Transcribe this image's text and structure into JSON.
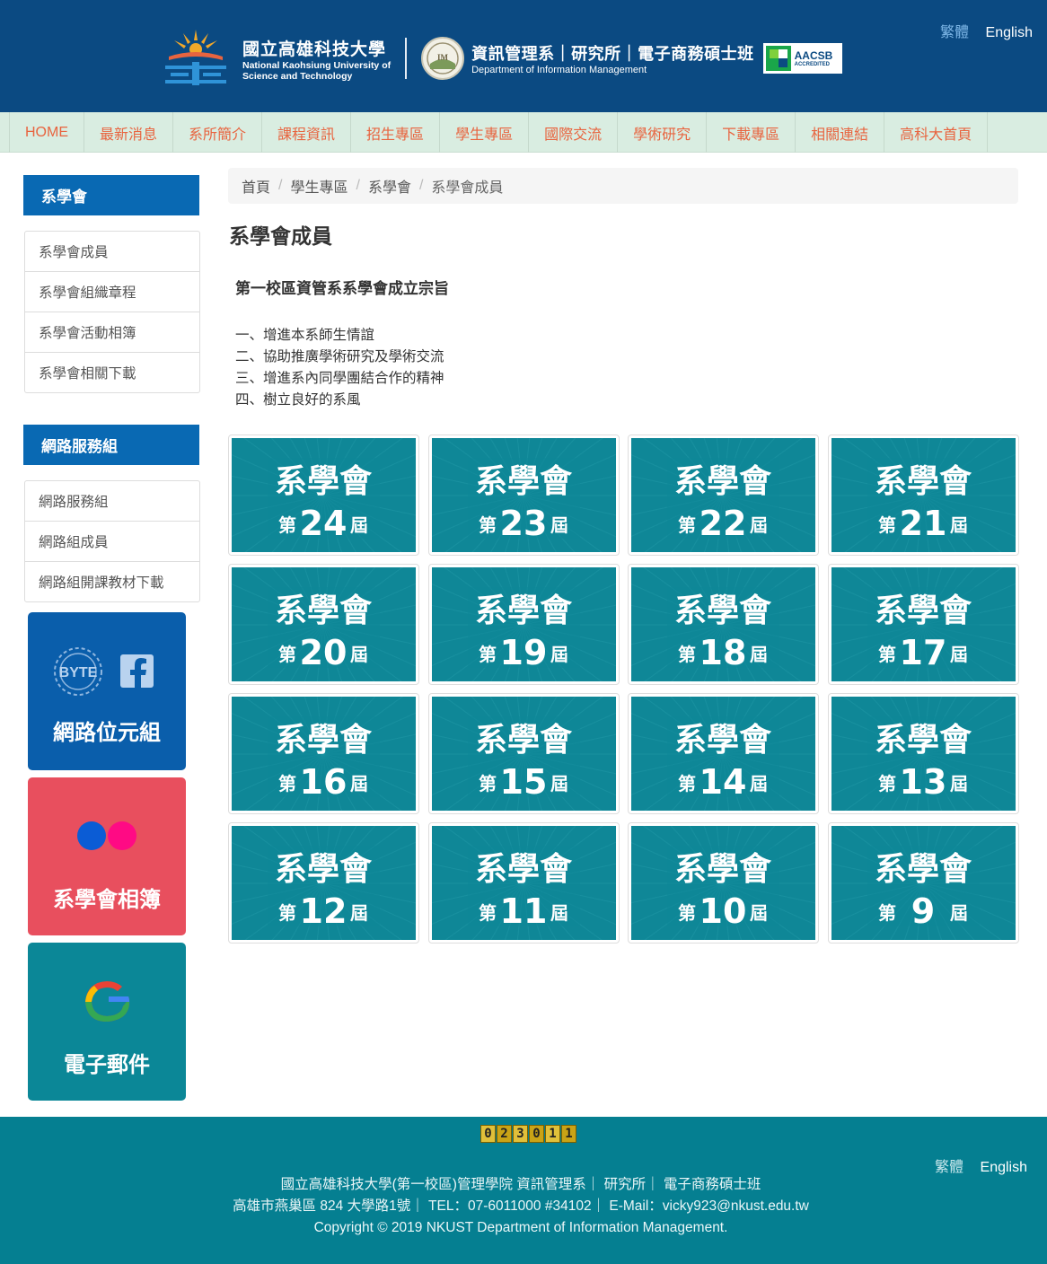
{
  "header": {
    "lang": [
      "繁體",
      "English"
    ],
    "univ_zh": "國立高雄科技大學",
    "univ_en_1": "National Kaohsiung University of",
    "univ_en_2": "Science and Technology",
    "dept_zh": "資訊管理系｜研究所｜電子商務碩士班",
    "dept_en": "Department of Information Management",
    "seal_text": "IM",
    "aacsb_1": "AACSB",
    "aacsb_2": "ACCREDITED"
  },
  "nav": [
    "HOME",
    "最新消息",
    "系所簡介",
    "課程資訊",
    "招生專區",
    "學生專區",
    "國際交流",
    "學術研究",
    "下載專區",
    "相關連結",
    "高科大首頁"
  ],
  "sidebar": {
    "group1_title": "系學會",
    "group1_items": [
      "系學會成員",
      "系學會組織章程",
      "系學會活動相簿",
      "系學會相關下載"
    ],
    "group2_title": "網路服務組",
    "group2_items": [
      "網路服務組",
      "網路組成員",
      "網路組開課教材下載"
    ],
    "tile1": "網路位元組",
    "tile1_badge": "BYTE",
    "tile2": "系學會相簿",
    "tile3": "電子郵件"
  },
  "breadcrumb": [
    "首頁",
    "學生專區",
    "系學會",
    "系學會成員"
  ],
  "page_title": "系學會成員",
  "purpose_title": "第一校區資管系系學會成立宗旨",
  "purpose_items": [
    "一、增進本系師生情誼",
    "二、協助推廣學術研究及學術交流",
    "三、增進系內同學團結合作的精神",
    "四、樹立良好的系風"
  ],
  "cards": {
    "title": "系學會",
    "prefix": "第",
    "suffix": "屆",
    "terms": [
      "24",
      "23",
      "22",
      "21",
      "20",
      "19",
      "18",
      "17",
      "16",
      "15",
      "14",
      "13",
      "12",
      "11",
      "10",
      "9"
    ]
  },
  "footer": {
    "counter": [
      "0",
      "2",
      "3",
      "0",
      "1",
      "1"
    ],
    "lang": [
      "繁體",
      "English"
    ],
    "line1": "國立高雄科技大學(第一校區)管理學院 資訊管理系｜ 研究所｜ 電子商務碩士班",
    "line2": "高雄市燕巢區 824 大學路1號｜ TEL：07-6011000 #34102｜ E-Mail：vicky923@nkust.edu.tw",
    "line3": "Copyright © 2019 NKUST Department of Information Management."
  },
  "colors": {
    "header_bg": "#0b4a82",
    "nav_bg": "#d9ede1",
    "nav_text": "#e8643f",
    "sidebar_head": "#0969b3",
    "card_bg": "#0f8797",
    "footer_bg": "#057f91",
    "tile_byte": "#0a5eab",
    "tile_flickr": "#e84f5e",
    "tile_mail": "#0b8797"
  },
  "icons": [
    "univ-emblem-icon",
    "dept-seal-icon",
    "aacsb-icon",
    "byte-icon",
    "facebook-icon",
    "flickr-icon",
    "google-icon"
  ]
}
